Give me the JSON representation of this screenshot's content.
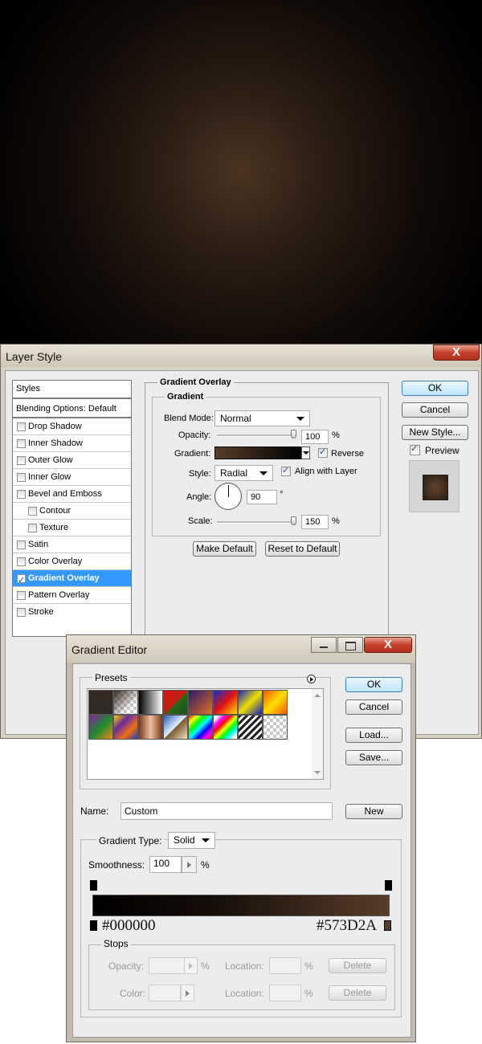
{
  "colors": {
    "gradient_start": "#000000",
    "gradient_end": "#573D2A",
    "selection": "#3399ff",
    "close_button": "#c7402a"
  },
  "layer_style": {
    "title": "Layer Style",
    "close_glyph": "X",
    "sidebar": {
      "header": "Styles",
      "items": [
        {
          "label": "Blending Options: Default",
          "checkbox": false,
          "checked": false
        },
        {
          "label": "Drop Shadow",
          "checkbox": true,
          "checked": false
        },
        {
          "label": "Inner Shadow",
          "checkbox": true,
          "checked": false
        },
        {
          "label": "Outer Glow",
          "checkbox": true,
          "checked": false
        },
        {
          "label": "Inner Glow",
          "checkbox": true,
          "checked": false
        },
        {
          "label": "Bevel and Emboss",
          "checkbox": true,
          "checked": false
        },
        {
          "label": "Contour",
          "checkbox": true,
          "checked": false
        },
        {
          "label": "Texture",
          "checkbox": true,
          "checked": false
        },
        {
          "label": "Satin",
          "checkbox": true,
          "checked": false
        },
        {
          "label": "Color Overlay",
          "checkbox": true,
          "checked": false
        },
        {
          "label": "Gradient Overlay",
          "checkbox": true,
          "checked": true
        },
        {
          "label": "Pattern Overlay",
          "checkbox": true,
          "checked": false
        },
        {
          "label": "Stroke",
          "checkbox": true,
          "checked": false
        }
      ]
    },
    "section_title": "Gradient Overlay",
    "group_title": "Gradient",
    "blend_mode": {
      "label": "Blend Mode:",
      "value": "Normal"
    },
    "opacity": {
      "label": "Opacity:",
      "value": "100",
      "unit": "%",
      "level": 1.0
    },
    "gradient": {
      "label": "Gradient:",
      "reverse_label": "Reverse",
      "reverse_checked": true
    },
    "style": {
      "label": "Style:",
      "value": "Radial",
      "align_label": "Align with Layer",
      "align_checked": true
    },
    "angle": {
      "label": "Angle:",
      "value": "90",
      "unit": "°"
    },
    "scale": {
      "label": "Scale:",
      "value": "150",
      "unit": "%",
      "level": 1.0
    },
    "make_default": "Make Default",
    "reset_default": "Reset to Default",
    "ok": "OK",
    "cancel": "Cancel",
    "new_style": "New Style...",
    "preview_label": "Preview",
    "preview_checked": true
  },
  "gradient_editor": {
    "title": "Gradient Editor",
    "presets_label": "Presets",
    "ok": "OK",
    "cancel": "Cancel",
    "load": "Load...",
    "save": "Save...",
    "name_label": "Name:",
    "name_value": "Custom",
    "new_button": "New",
    "gradient_type_label": "Gradient Type:",
    "gradient_type_value": "Solid",
    "smoothness_label": "Smoothness:",
    "smoothness_value": "100",
    "smoothness_unit": "%",
    "stop_left_hex": "#000000",
    "stop_right_hex": "#573D2A",
    "stops": {
      "title": "Stops",
      "opacity_label": "Opacity:",
      "color_label": "Color:",
      "location_label": "Location:",
      "percent": "%",
      "delete": "Delete"
    }
  }
}
